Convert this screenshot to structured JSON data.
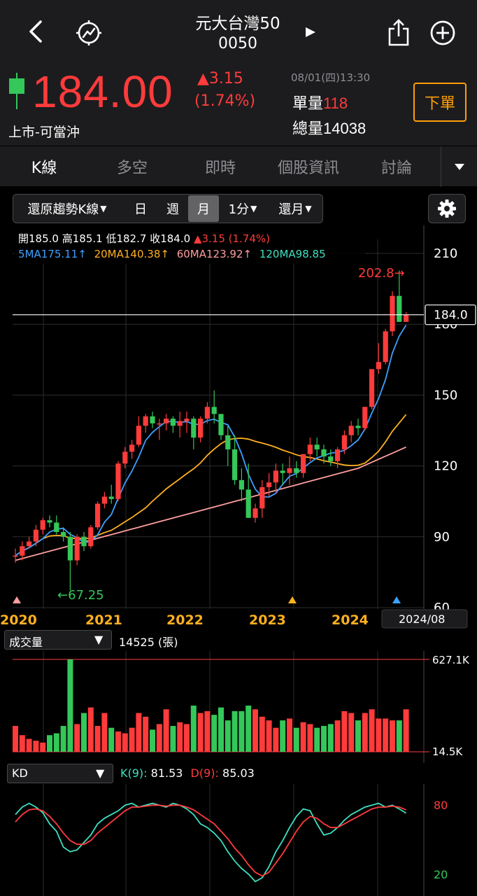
{
  "header": {
    "back_icon": "chevron-left-icon",
    "compare_icon": "compare-chart-icon",
    "name": "元大台灣50",
    "code": "0050",
    "next_icon": "play-right-icon",
    "share_icon": "share-icon",
    "add_icon": "plus-circle-icon"
  },
  "quote": {
    "price": "184.00",
    "change": "▲3.15",
    "change_pct": "(1.74%)",
    "market": "上市-可當沖",
    "datetime": "08/01(四)13:30",
    "unit_vol_label": "單量",
    "unit_vol": "118",
    "total_vol_label": "總量",
    "total_vol": "14038",
    "order_label": "下單",
    "up_color": "#ff3b3b",
    "down_color": "#34c759"
  },
  "tabs": [
    {
      "label": "K線",
      "active": true
    },
    {
      "label": "多空"
    },
    {
      "label": "即時"
    },
    {
      "label": "個股資訊"
    },
    {
      "label": "討論"
    }
  ],
  "toolbar": {
    "mode": "還原趨勢K線",
    "periods": [
      "日",
      "週",
      "月",
      "1分"
    ],
    "selected": "月",
    "range": "還月"
  },
  "ohlc_line": {
    "open": "開185.0",
    "high": "高185.1",
    "low": "低182.7",
    "close": "收184.0",
    "change": "▲3.15 (1.74%)"
  },
  "ma_line": [
    {
      "label": "5MA175.11↑",
      "color": "#3ea0ff"
    },
    {
      "label": "20MA140.38↑",
      "color": "#ffb020"
    },
    {
      "label": "60MA123.92↑",
      "color": "#ff9e9e"
    },
    {
      "label": "120MA98.85",
      "color": "#3ee0c0"
    }
  ],
  "volume_panel": {
    "selector": "成交量",
    "value": "14525 (張)",
    "max_label": "627.1K",
    "min_label": "14.5K"
  },
  "kd_panel": {
    "selector": "KD",
    "k_label": "K(9):",
    "k_value": "81.53",
    "d_label": "D(9):",
    "d_value": "85.03",
    "y_labels": [
      "80",
      "20"
    ]
  },
  "chart_data": {
    "type": "candlestick",
    "period": "monthly",
    "y_ticks": [
      60,
      90,
      120,
      150,
      180,
      210
    ],
    "ylim": [
      60,
      212
    ],
    "current_price_label": "184.0",
    "max_label": "202.8→",
    "min_label": "←67.25",
    "x_labels": [
      "2020",
      "2021",
      "2022",
      "2023",
      "2024"
    ],
    "cursor_label": "2024/08",
    "candles": [
      [
        82,
        85,
        79,
        82
      ],
      [
        82,
        88,
        80,
        86
      ],
      [
        86,
        90,
        85,
        88
      ],
      [
        88,
        95,
        86,
        93
      ],
      [
        93,
        98,
        91,
        97
      ],
      [
        97,
        99,
        94,
        96
      ],
      [
        96,
        99,
        91,
        92
      ],
      [
        92,
        94,
        88,
        90
      ],
      [
        90,
        92,
        67.25,
        80
      ],
      [
        80,
        91,
        78,
        90
      ],
      [
        90,
        92,
        84,
        86
      ],
      [
        86,
        95,
        85,
        94
      ],
      [
        94,
        105,
        93,
        104
      ],
      [
        104,
        109,
        102,
        107
      ],
      [
        107,
        112,
        104,
        106
      ],
      [
        106,
        122,
        105,
        121
      ],
      [
        121,
        128,
        119,
        126
      ],
      [
        126,
        131,
        123,
        129
      ],
      [
        129,
        141,
        128,
        137
      ],
      [
        137,
        142,
        134,
        141
      ],
      [
        141,
        143,
        136,
        138
      ],
      [
        138,
        140,
        131,
        138
      ],
      [
        138,
        142,
        135,
        140
      ],
      [
        140,
        141,
        134,
        137
      ],
      [
        137,
        143,
        132,
        139
      ],
      [
        139,
        143,
        134,
        140
      ],
      [
        140,
        141,
        127,
        132
      ],
      [
        132,
        141,
        130,
        140
      ],
      [
        140,
        147,
        138,
        145
      ],
      [
        145,
        152,
        138,
        142
      ],
      [
        142,
        140,
        131,
        133
      ],
      [
        133,
        137,
        120,
        127
      ],
      [
        127,
        133,
        112,
        114
      ],
      [
        114,
        119,
        105,
        110
      ],
      [
        110,
        121,
        100,
        98
      ],
      [
        98,
        104,
        96,
        102
      ],
      [
        102,
        114,
        98,
        111
      ],
      [
        111,
        117,
        107,
        113
      ],
      [
        113,
        121,
        108,
        118
      ],
      [
        118,
        121,
        112,
        117
      ],
      [
        117,
        124,
        112,
        119
      ],
      [
        119,
        122,
        115,
        117
      ],
      [
        117,
        125,
        115,
        125
      ],
      [
        125,
        132,
        122,
        129
      ],
      [
        129,
        132,
        124,
        127
      ],
      [
        127,
        129,
        121,
        124
      ],
      [
        124,
        127,
        120,
        122
      ],
      [
        122,
        128,
        119,
        127
      ],
      [
        127,
        135,
        125,
        133
      ],
      [
        133,
        139,
        130,
        137
      ],
      [
        137,
        140,
        133,
        136
      ],
      [
        136,
        145,
        135,
        145
      ],
      [
        145,
        160,
        144,
        161
      ],
      [
        161,
        172,
        159,
        164
      ],
      [
        164,
        178,
        163,
        177
      ],
      [
        177,
        194,
        175,
        192
      ],
      [
        192,
        202.8,
        181,
        181
      ],
      [
        181,
        185.1,
        182.7,
        184
      ]
    ],
    "ma5_last": 175.11,
    "ma20_last": 140.38,
    "ma60_last": 123.92,
    "ma120_last": 98.85,
    "volume_ylim_label": [
      "14.5K",
      "627.1K"
    ],
    "kd_last": {
      "K": 81.53,
      "D": 85.03
    }
  }
}
